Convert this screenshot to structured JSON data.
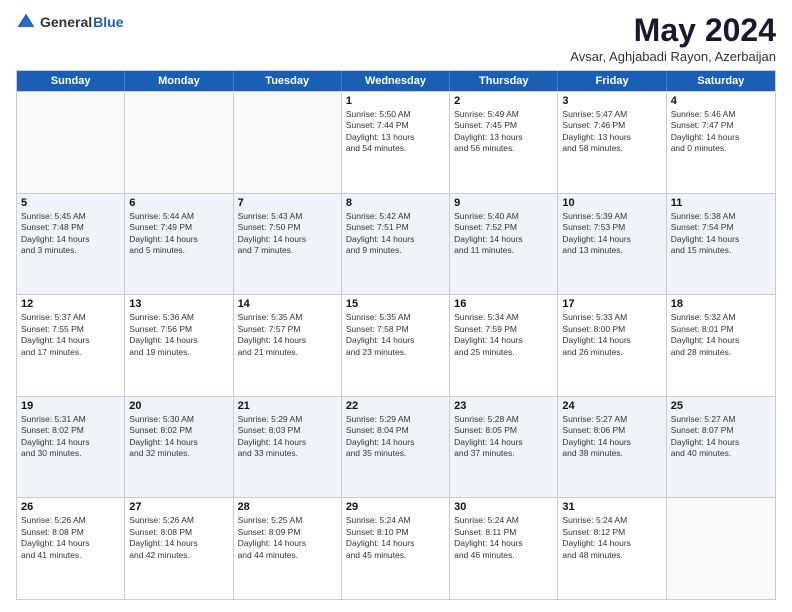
{
  "logo": {
    "general": "General",
    "blue": "Blue"
  },
  "title": "May 2024",
  "location": "Avsar, Aghjabadi Rayon, Azerbaijan",
  "headers": [
    "Sunday",
    "Monday",
    "Tuesday",
    "Wednesday",
    "Thursday",
    "Friday",
    "Saturday"
  ],
  "rows": [
    [
      {
        "day": "",
        "text": ""
      },
      {
        "day": "",
        "text": ""
      },
      {
        "day": "",
        "text": ""
      },
      {
        "day": "1",
        "text": "Sunrise: 5:50 AM\nSunset: 7:44 PM\nDaylight: 13 hours\nand 54 minutes."
      },
      {
        "day": "2",
        "text": "Sunrise: 5:49 AM\nSunset: 7:45 PM\nDaylight: 13 hours\nand 56 minutes."
      },
      {
        "day": "3",
        "text": "Sunrise: 5:47 AM\nSunset: 7:46 PM\nDaylight: 13 hours\nand 58 minutes."
      },
      {
        "day": "4",
        "text": "Sunrise: 5:46 AM\nSunset: 7:47 PM\nDaylight: 14 hours\nand 0 minutes."
      }
    ],
    [
      {
        "day": "5",
        "text": "Sunrise: 5:45 AM\nSunset: 7:48 PM\nDaylight: 14 hours\nand 3 minutes."
      },
      {
        "day": "6",
        "text": "Sunrise: 5:44 AM\nSunset: 7:49 PM\nDaylight: 14 hours\nand 5 minutes."
      },
      {
        "day": "7",
        "text": "Sunrise: 5:43 AM\nSunset: 7:50 PM\nDaylight: 14 hours\nand 7 minutes."
      },
      {
        "day": "8",
        "text": "Sunrise: 5:42 AM\nSunset: 7:51 PM\nDaylight: 14 hours\nand 9 minutes."
      },
      {
        "day": "9",
        "text": "Sunrise: 5:40 AM\nSunset: 7:52 PM\nDaylight: 14 hours\nand 11 minutes."
      },
      {
        "day": "10",
        "text": "Sunrise: 5:39 AM\nSunset: 7:53 PM\nDaylight: 14 hours\nand 13 minutes."
      },
      {
        "day": "11",
        "text": "Sunrise: 5:38 AM\nSunset: 7:54 PM\nDaylight: 14 hours\nand 15 minutes."
      }
    ],
    [
      {
        "day": "12",
        "text": "Sunrise: 5:37 AM\nSunset: 7:55 PM\nDaylight: 14 hours\nand 17 minutes."
      },
      {
        "day": "13",
        "text": "Sunrise: 5:36 AM\nSunset: 7:56 PM\nDaylight: 14 hours\nand 19 minutes."
      },
      {
        "day": "14",
        "text": "Sunrise: 5:35 AM\nSunset: 7:57 PM\nDaylight: 14 hours\nand 21 minutes."
      },
      {
        "day": "15",
        "text": "Sunrise: 5:35 AM\nSunset: 7:58 PM\nDaylight: 14 hours\nand 23 minutes."
      },
      {
        "day": "16",
        "text": "Sunrise: 5:34 AM\nSunset: 7:59 PM\nDaylight: 14 hours\nand 25 minutes."
      },
      {
        "day": "17",
        "text": "Sunrise: 5:33 AM\nSunset: 8:00 PM\nDaylight: 14 hours\nand 26 minutes."
      },
      {
        "day": "18",
        "text": "Sunrise: 5:32 AM\nSunset: 8:01 PM\nDaylight: 14 hours\nand 28 minutes."
      }
    ],
    [
      {
        "day": "19",
        "text": "Sunrise: 5:31 AM\nSunset: 8:02 PM\nDaylight: 14 hours\nand 30 minutes."
      },
      {
        "day": "20",
        "text": "Sunrise: 5:30 AM\nSunset: 8:02 PM\nDaylight: 14 hours\nand 32 minutes."
      },
      {
        "day": "21",
        "text": "Sunrise: 5:29 AM\nSunset: 8:03 PM\nDaylight: 14 hours\nand 33 minutes."
      },
      {
        "day": "22",
        "text": "Sunrise: 5:29 AM\nSunset: 8:04 PM\nDaylight: 14 hours\nand 35 minutes."
      },
      {
        "day": "23",
        "text": "Sunrise: 5:28 AM\nSunset: 8:05 PM\nDaylight: 14 hours\nand 37 minutes."
      },
      {
        "day": "24",
        "text": "Sunrise: 5:27 AM\nSunset: 8:06 PM\nDaylight: 14 hours\nand 38 minutes."
      },
      {
        "day": "25",
        "text": "Sunrise: 5:27 AM\nSunset: 8:07 PM\nDaylight: 14 hours\nand 40 minutes."
      }
    ],
    [
      {
        "day": "26",
        "text": "Sunrise: 5:26 AM\nSunset: 8:08 PM\nDaylight: 14 hours\nand 41 minutes."
      },
      {
        "day": "27",
        "text": "Sunrise: 5:26 AM\nSunset: 8:08 PM\nDaylight: 14 hours\nand 42 minutes."
      },
      {
        "day": "28",
        "text": "Sunrise: 5:25 AM\nSunset: 8:09 PM\nDaylight: 14 hours\nand 44 minutes."
      },
      {
        "day": "29",
        "text": "Sunrise: 5:24 AM\nSunset: 8:10 PM\nDaylight: 14 hours\nand 45 minutes."
      },
      {
        "day": "30",
        "text": "Sunrise: 5:24 AM\nSunset: 8:11 PM\nDaylight: 14 hours\nand 46 minutes."
      },
      {
        "day": "31",
        "text": "Sunrise: 5:24 AM\nSunset: 8:12 PM\nDaylight: 14 hours\nand 48 minutes."
      },
      {
        "day": "",
        "text": ""
      }
    ]
  ]
}
